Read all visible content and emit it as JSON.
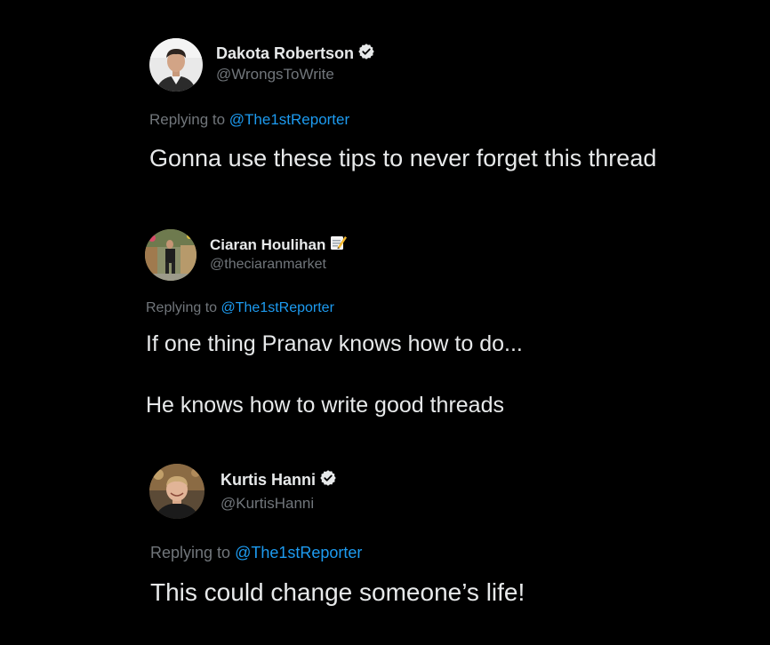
{
  "colors": {
    "background": "#000000",
    "text_primary": "#e7e9ea",
    "text_secondary": "#71767b",
    "mention": "#1d9bf0",
    "verified_badge": "#e7e9ea"
  },
  "tweets": [
    {
      "display_name": "Dakota Robertson",
      "badge_icon": "verified-badge-icon",
      "handle": "@WrongsToWrite",
      "replying_prefix": "Replying to ",
      "replying_to": "@The1stReporter",
      "text": "Gonna use these tips to never forget this thread"
    },
    {
      "display_name": "Ciaran Houlihan",
      "badge_icon": "memo-emoji-icon",
      "handle": "@theciaranmarket",
      "replying_prefix": "Replying to ",
      "replying_to": "@The1stReporter",
      "text_lines": [
        "If one thing Pranav knows how to do...",
        "He knows how to write good threads"
      ]
    },
    {
      "display_name": "Kurtis Hanni",
      "badge_icon": "verified-badge-icon",
      "handle": "@KurtisHanni",
      "replying_prefix": "Replying to ",
      "replying_to": "@The1stReporter",
      "text": "This could change someone’s life!"
    }
  ]
}
